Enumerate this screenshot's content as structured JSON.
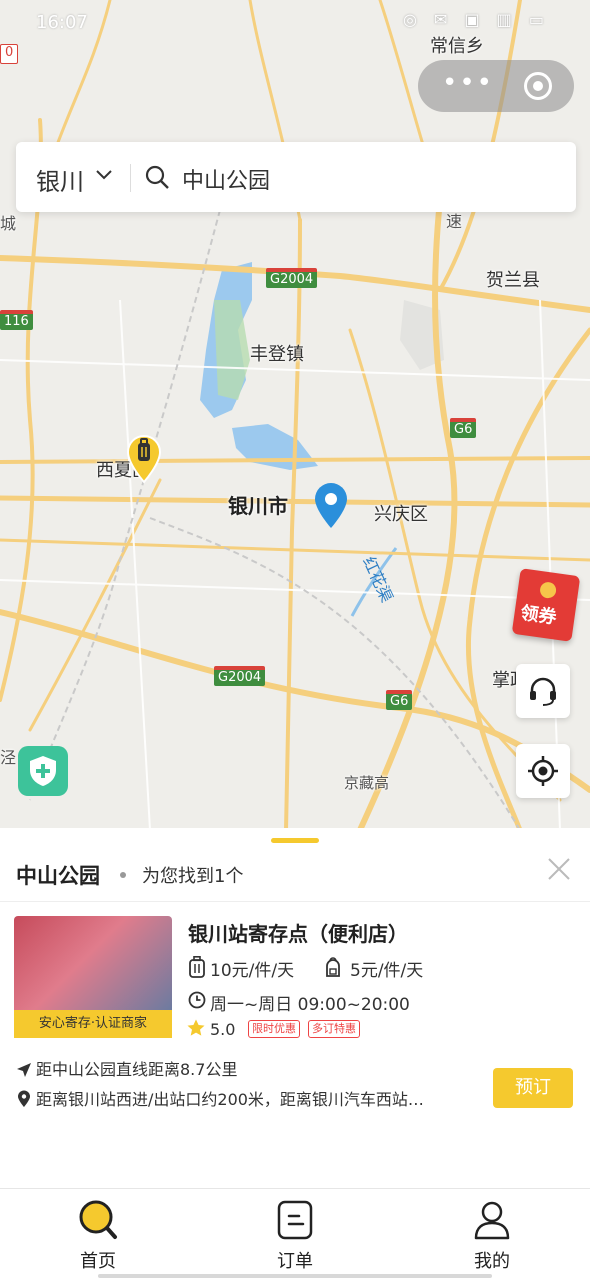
{
  "status_bar": {
    "time": "16:07",
    "icons": "◎ ✉ ▣ ▥ ▭"
  },
  "search": {
    "city": "银川",
    "query": "中山公园"
  },
  "map": {
    "labels": {
      "changxin": "常信乡",
      "helan": "贺兰县",
      "fengdeng": "丰登镇",
      "xixia": "西夏区",
      "yinchuan": "银川市",
      "xingqing": "兴庆区",
      "zhang": "掌政",
      "jing": "泾",
      "cheng": "城",
      "river": "红花渠",
      "jingzang": "京藏高",
      "su": "速",
      "xi": "西",
      "su_side": "116"
    },
    "shields": {
      "g2004_top": "G2004",
      "g2004_bottom": "G2004",
      "g6_right": "G6",
      "g6_bottom": "G6",
      "side_116": "116",
      "side_0": "0"
    },
    "coupon_label": "领券",
    "colors": {
      "road": "#f7d68a",
      "water": "#8ec2ea",
      "pin": "#2b8fdb"
    }
  },
  "sheet": {
    "search_title": "中山公园",
    "found_text": "为您找到1个",
    "store": {
      "name": "银川站寄存点（便利店）",
      "badge": "安心寄存·认证商家",
      "price_suitcase": "10元/件/天",
      "price_bag": "5元/件/天",
      "hours": "周一~周日 09:00~20:00",
      "rating": "5.0",
      "tags": [
        "限时优惠",
        "多订特惠"
      ],
      "distance": "距中山公园直线距离8.7公里",
      "address": "距离银川站西进/出站口约200米，距离银川汽车西站…",
      "book_label": "预订"
    }
  },
  "tabs": [
    {
      "label": "首页",
      "icon": "search-icon"
    },
    {
      "label": "订单",
      "icon": "order-icon"
    },
    {
      "label": "我的",
      "icon": "profile-icon"
    }
  ],
  "accent_color": "#f5c92e"
}
